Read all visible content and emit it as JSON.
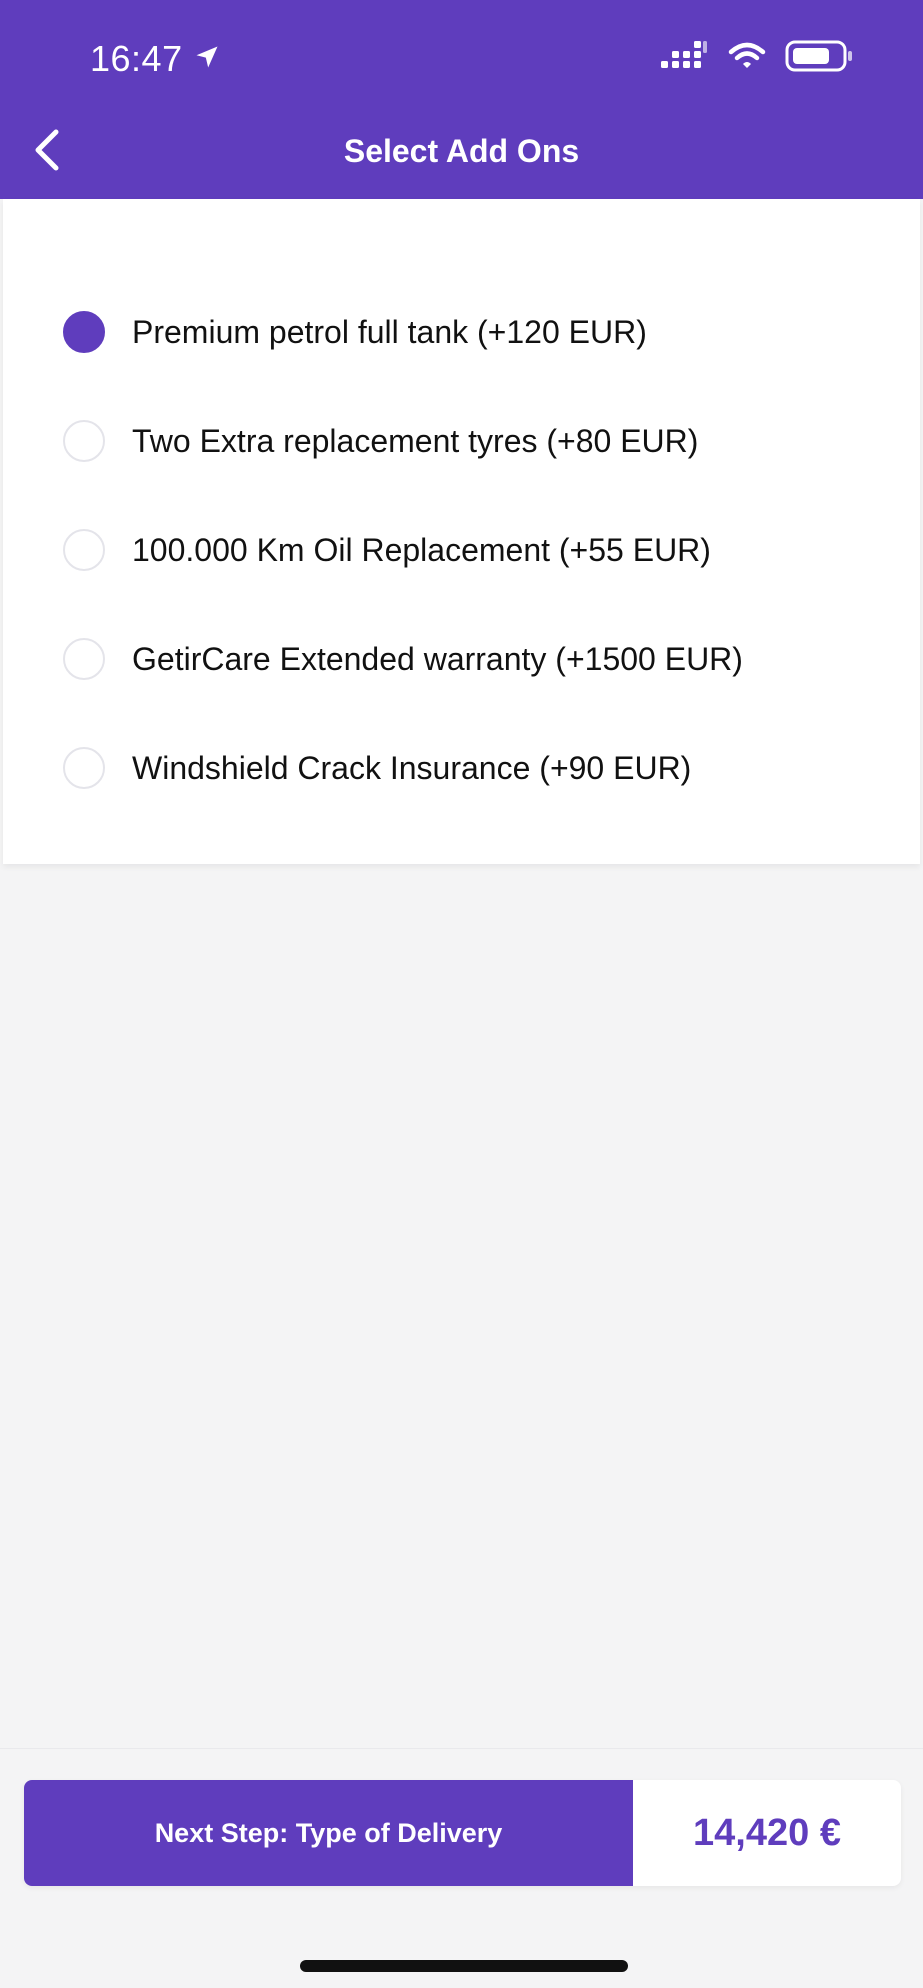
{
  "status_bar": {
    "time": "16:47",
    "icons": [
      "location-arrow-icon",
      "cellular-signal-icon",
      "wifi-icon",
      "battery-icon"
    ]
  },
  "header": {
    "title": "Select Add Ons",
    "back_icon": "chevron-left-icon"
  },
  "options": [
    {
      "label": "Premium petrol full tank (+120 EUR)",
      "selected": true
    },
    {
      "label": "Two Extra replacement tyres (+80 EUR)",
      "selected": false
    },
    {
      "label": "100.000 Km Oil Replacement (+55 EUR)",
      "selected": false
    },
    {
      "label": "GetirCare Extended warranty (+1500 EUR)",
      "selected": false
    },
    {
      "label": "Windshield Crack Insurance (+90 EUR)",
      "selected": false
    }
  ],
  "footer": {
    "next_step_label": "Next Step: Type of Delivery",
    "price": "14,420 €"
  },
  "colors": {
    "brand": "#5f3dbd",
    "background": "#f4f4f5",
    "card": "#ffffff",
    "text": "#111111"
  }
}
